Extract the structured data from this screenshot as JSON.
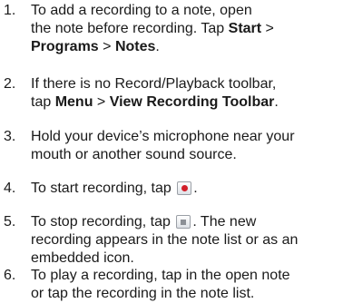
{
  "steps": [
    {
      "number": "1.",
      "lines": {
        "l1": "To add a recording to a note, open",
        "l2": "the note before recording. Tap ",
        "l2_bold1": "Start",
        "l2_sep": " >",
        "l3_bold1": "Programs",
        "l3_sep": " > ",
        "l3_bold2": "Notes",
        "l3_end": "."
      }
    },
    {
      "number": "2.",
      "lines": {
        "l1": "If there is no Record/Playback toolbar,",
        "l2": "tap ",
        "l2_bold1": "Menu",
        "l2_sep": " > ",
        "l2_bold2": "View Recording Toolbar",
        "l2_end": "."
      }
    },
    {
      "number": "3.",
      "lines": {
        "l1": "Hold your device’s microphone near your",
        "l2": "mouth or another sound source."
      }
    },
    {
      "number": "4.",
      "lines": {
        "l1": "To start recording, tap ",
        "l1_end": ".",
        "icon": "record-icon"
      }
    },
    {
      "number": "5.",
      "lines": {
        "l1": "To stop recording, tap ",
        "l1_end": ". The new",
        "icon": "stop-icon",
        "l2": "recording appears in the note list or as an",
        "l3": "embedded icon."
      }
    },
    {
      "number": "6.",
      "lines": {
        "l1": "To play a recording, tap in the open note",
        "l2": "or tap the recording in the note list."
      }
    }
  ]
}
